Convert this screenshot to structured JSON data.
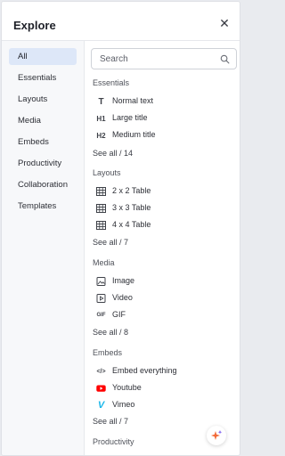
{
  "header": {
    "title": "Explore"
  },
  "sidebar": {
    "items": [
      {
        "label": "All",
        "active": true
      },
      {
        "label": "Essentials"
      },
      {
        "label": "Layouts"
      },
      {
        "label": "Media"
      },
      {
        "label": "Embeds"
      },
      {
        "label": "Productivity"
      },
      {
        "label": "Collaboration"
      },
      {
        "label": "Templates"
      }
    ]
  },
  "search": {
    "placeholder": "Search",
    "value": ""
  },
  "sections": {
    "essentials": {
      "title": "Essentials",
      "items": [
        {
          "label": "Normal text",
          "icon": "T",
          "icon_name": "text-icon"
        },
        {
          "label": "Large title",
          "icon": "H1",
          "icon_name": "heading1-icon"
        },
        {
          "label": "Medium title",
          "icon": "H2",
          "icon_name": "heading2-icon"
        }
      ],
      "see_all": "See all / 14"
    },
    "layouts": {
      "title": "Layouts",
      "items": [
        {
          "label": "2 x 2 Table",
          "icon_name": "table-icon"
        },
        {
          "label": "3 x 3 Table",
          "icon_name": "table-icon"
        },
        {
          "label": "4 x 4 Table",
          "icon_name": "table-icon"
        }
      ],
      "see_all": "See all / 7"
    },
    "media": {
      "title": "Media",
      "items": [
        {
          "label": "Image",
          "icon_name": "image-icon"
        },
        {
          "label": "Video",
          "icon_name": "video-icon"
        },
        {
          "label": "GIF",
          "icon": "GIF",
          "icon_name": "gif-icon"
        }
      ],
      "see_all": "See all / 8"
    },
    "embeds": {
      "title": "Embeds",
      "items": [
        {
          "label": "Embed everything",
          "icon": "</>",
          "icon_name": "code-icon"
        },
        {
          "label": "Youtube",
          "icon_name": "youtube-icon"
        },
        {
          "label": "Vimeo",
          "icon": "V",
          "icon_name": "vimeo-icon"
        }
      ],
      "see_all": "See all / 7"
    },
    "productivity": {
      "title": "Productivity"
    }
  },
  "colors": {
    "accent": "#dde7f8",
    "youtube": "#ff0000",
    "vimeo": "#1ab7ea"
  }
}
